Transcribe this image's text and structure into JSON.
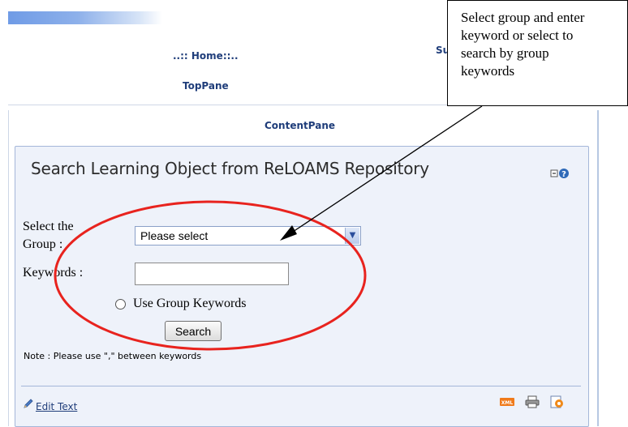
{
  "nav": {
    "home_label": "..:: Home::..",
    "partial_label": "Su",
    "top_pane_label": "TopPane",
    "content_pane_label": "ContentPane"
  },
  "module": {
    "title": "Search Learning Object from ReLOAMS Repository",
    "help_icon": "minimize-help-icon",
    "group_label_line1": "Select the",
    "group_label_line2": "Group :",
    "group_select_value": "Please select",
    "keywords_label": "Keywords :",
    "keywords_value": "",
    "radio_label": "Use Group Keywords",
    "search_button_label": "Search",
    "note": "Note : Please use \",\" between keywords",
    "edit_text_label": "Edit Text",
    "footer_icons": [
      "xml-icon",
      "print-icon",
      "syndicate-icon"
    ]
  },
  "callout": {
    "line1": "Select group and enter",
    "line2": "keyword or select to",
    "line3": "search by group",
    "line4": "keywords"
  },
  "colors": {
    "annotation_ellipse": "#e8231e",
    "link_blue": "#1f3d7a",
    "module_bg": "#eef2fa"
  }
}
